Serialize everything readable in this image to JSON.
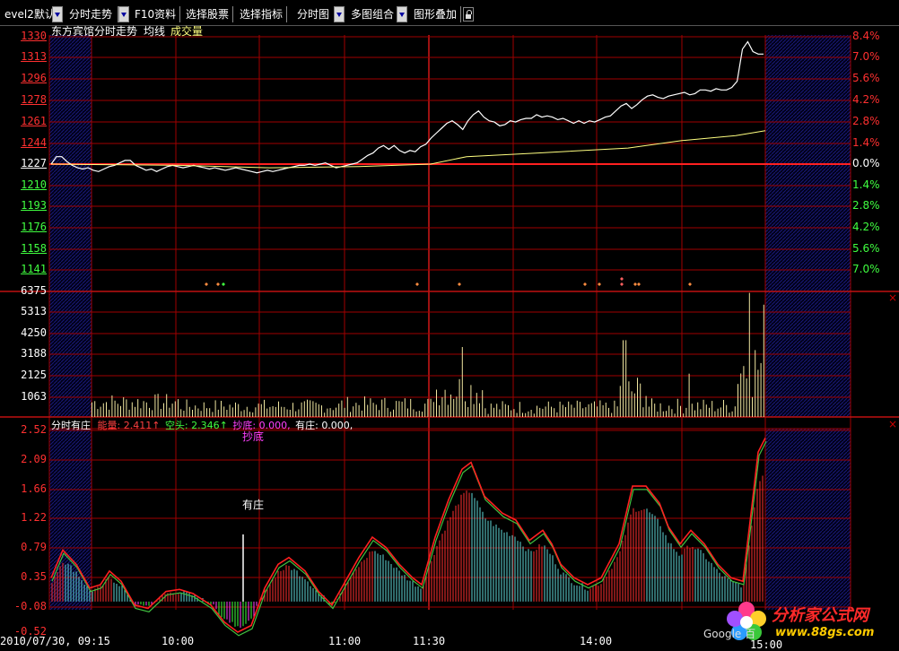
{
  "toolbar": {
    "items": [
      "evel2默认",
      "分时走势",
      "F10资料",
      "选择股票",
      "选择指标",
      "分时图",
      "多图组合",
      "图形叠加"
    ]
  },
  "chart_header": {
    "stock_title": "东方宾馆分时走势",
    "avg_label": "均线",
    "vol_label": "成交量"
  },
  "price_axis": [
    "1330",
    "1313",
    "1296",
    "1278",
    "1261",
    "1244",
    "1227",
    "1210",
    "1193",
    "1176",
    "1158",
    "1141"
  ],
  "pct_axis": [
    "8.4%",
    "7.0%",
    "5.6%",
    "4.2%",
    "2.8%",
    "1.4%",
    "0.0%",
    "1.4%",
    "2.8%",
    "4.2%",
    "5.6%",
    "7.0%"
  ],
  "volume_axis": [
    "6375",
    "5313",
    "4250",
    "3188",
    "2125",
    "1063"
  ],
  "indicator_axis": [
    "2.52",
    "2.09",
    "1.66",
    "1.22",
    "0.79",
    "0.35",
    "-0.08",
    "-0.52"
  ],
  "indicator_header": {
    "name": "分时有庄",
    "k1": "能量:",
    "v1": "2.411↑",
    "k2": "空头:",
    "v2": "2.346↑",
    "k3": "抄底:",
    "v3": "0.000,",
    "k4": "有庄:",
    "v4": "0.000,"
  },
  "annotations": {
    "chaodi": "抄底",
    "youzhuang": "有庄"
  },
  "time_axis": [
    "2010/07/30, 09:15",
    "10:00",
    "11:00",
    "11:30",
    "14:00",
    "15:00"
  ],
  "watermark": {
    "title": "分析家公式网",
    "url": "www.88gs.com",
    "google": "Google 百"
  },
  "colors": {
    "up": "#ff3030",
    "down": "#40ff40",
    "grid": "#a00000",
    "price_line": "#ffffff",
    "avg_line": "#ffff80",
    "volume": "#f0e6a0",
    "cyan": "#5fd7d7"
  },
  "chart_data": {
    "type": "line",
    "price_series": [
      1227,
      1233,
      1233,
      1229,
      1226,
      1224,
      1223,
      1224,
      1222,
      1221,
      1223,
      1225,
      1226,
      1228,
      1230,
      1230,
      1226,
      1224,
      1222,
      1223,
      1221,
      1223,
      1225,
      1226,
      1225,
      1224,
      1225,
      1226,
      1225,
      1224,
      1223,
      1224,
      1223,
      1222,
      1223,
      1224,
      1223,
      1222,
      1221,
      1220,
      1221,
      1222,
      1221,
      1222,
      1223,
      1224,
      1225,
      1226,
      1226,
      1227,
      1226,
      1227,
      1228,
      1226,
      1224,
      1225,
      1226,
      1227,
      1228,
      1231,
      1234,
      1236,
      1240,
      1242,
      1239,
      1242,
      1238,
      1236,
      1238,
      1237,
      1241,
      1243,
      1248,
      1252,
      1256,
      1260,
      1262,
      1259,
      1255,
      1262,
      1267,
      1270,
      1265,
      1262,
      1261,
      1258,
      1259,
      1262,
      1261,
      1263,
      1264,
      1264,
      1267,
      1265,
      1266,
      1265,
      1263,
      1264,
      1262,
      1260,
      1262,
      1260,
      1262,
      1261,
      1263,
      1265,
      1266,
      1270,
      1274,
      1276,
      1272,
      1275,
      1279,
      1282,
      1283,
      1281,
      1280,
      1282,
      1283,
      1284,
      1285,
      1283,
      1284,
      1287,
      1287,
      1286,
      1288,
      1287,
      1287,
      1289,
      1294,
      1320,
      1326,
      1318,
      1316,
      1316
    ],
    "avg_series_start": 1227,
    "avg_series_end": 1262,
    "indicator_energy_peak": 2.411,
    "indicator_bear_peak": 2.346
  }
}
